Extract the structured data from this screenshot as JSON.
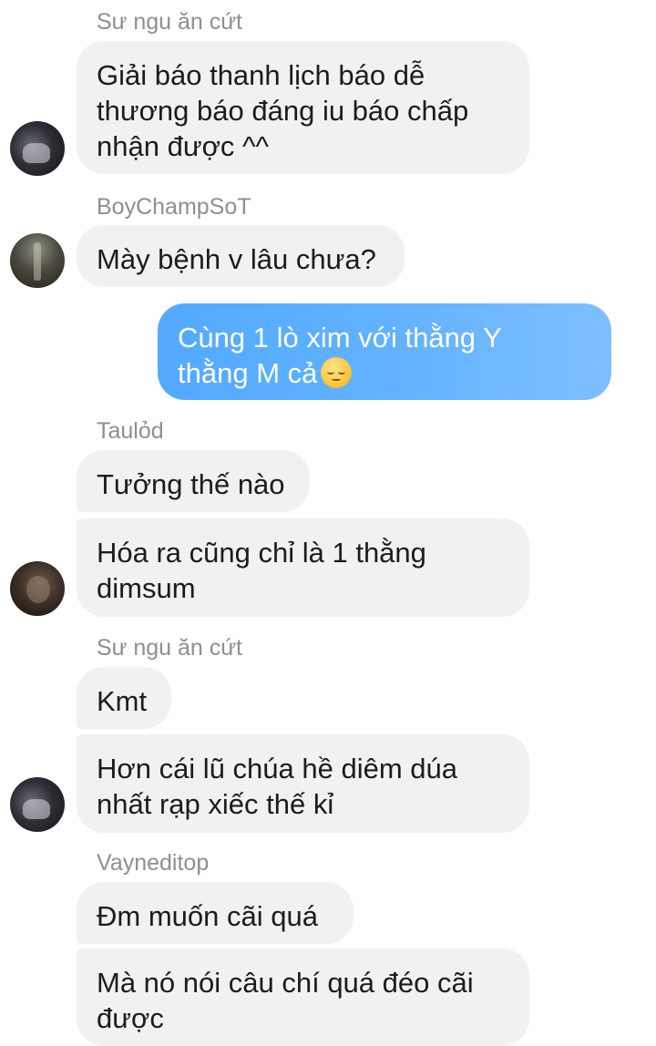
{
  "messages": [
    {
      "sender": "Sư ngu ăn cứt",
      "text": "Giải báo thanh lịch báo dễ\nthương báo đáng iu báo chấp\nnhận được ^^"
    },
    {
      "sender": "BoyChampSoT",
      "text": "Mày bệnh v lâu chưa?"
    },
    {
      "outgoing": true,
      "text": "Cùng 1 lò xim với thằng Y\nthằng M cả",
      "emoji": "relieved-face-emoji"
    },
    {
      "sender": "Taulỏd",
      "text_1": "Tưởng thế nào",
      "text_2": "Hóa ra cũng chỉ là 1 thằng\ndimsum"
    },
    {
      "sender": "Sư ngu ăn cứt",
      "text_1": "Kmt",
      "text_2": "Hơn cái lũ chúa hề diêm dúa\nnhất rạp xiếc thế kỉ"
    },
    {
      "sender": "Vayneditop",
      "text_1": "Đm muốn cãi quá",
      "text_2": "Mà nó nói câu chí quá đéo cãi\nđược"
    }
  ],
  "colors": {
    "incoming_bubble": "#f1f1f1",
    "outgoing_bubble_start": "#52a9ff",
    "outgoing_bubble_end": "#7dbfff",
    "sender_name": "#8e8e93",
    "text": "#1c1c1c"
  }
}
